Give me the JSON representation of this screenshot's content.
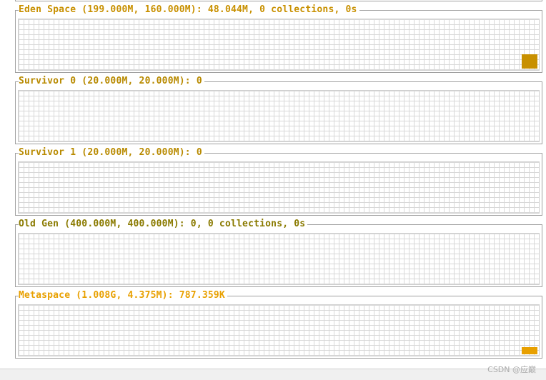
{
  "panels": [
    {
      "title": "Eden Space (199.000M, 160.000M): 48.044M, 0 collections, 0s",
      "color": "#c89000",
      "usage_bar_color": "#c89000"
    },
    {
      "title": "Survivor 0 (20.000M, 20.000M): 0",
      "color": "#b88a00"
    },
    {
      "title": "Survivor 1 (20.000M, 20.000M): 0",
      "color": "#b88a00"
    },
    {
      "title": "Old Gen (400.000M, 400.000M): 0, 0 collections, 0s",
      "color": "#8a7a00"
    },
    {
      "title": "Metaspace (1.008G, 4.375M): 787.359K",
      "color": "#e8a000",
      "usage_bar_color": "#e8a000"
    }
  ],
  "watermark": "CSDN @应巅"
}
